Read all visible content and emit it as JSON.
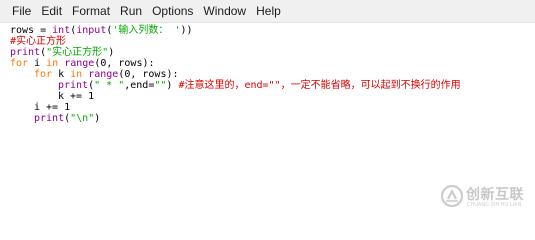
{
  "menu": {
    "items": [
      "File",
      "Edit",
      "Format",
      "Run",
      "Options",
      "Window",
      "Help"
    ]
  },
  "code": {
    "line1": {
      "a": "rows = ",
      "b": "int",
      "c": "(",
      "d": "input",
      "e": "(",
      "f": "'输入列数： '",
      "g": "))"
    },
    "line2": {
      "a": "#实心正方形"
    },
    "line3": {
      "a": "print",
      "b": "(",
      "c": "\"实心正方形\"",
      "d": ")"
    },
    "line4": {
      "a": "for",
      "b": " i ",
      "c": "in",
      "d": " ",
      "e": "range",
      "f": "(0, rows):"
    },
    "line5": {
      "a": "for",
      "b": " k ",
      "c": "in",
      "d": " ",
      "e": "range",
      "f": "(0, rows):"
    },
    "line6": {
      "a": "print",
      "b": "(",
      "c": "\" * \"",
      "d": ",end=",
      "e": "\"\"",
      "f": ") ",
      "g": "#注意这里的，end=\"\"，一定不能省略，可以起到不换行的作用"
    },
    "line7": {
      "a": "k += 1"
    },
    "line8": {
      "a": "i += 1"
    },
    "line9": {
      "a": "print",
      "b": "(",
      "c": "\"\\n\"",
      "d": ")"
    }
  },
  "watermark": {
    "brand": "创新互联",
    "sub": "CHUANG XIN HU LIAN"
  },
  "colors": {
    "keyword": "#ff7700",
    "builtin": "#900090",
    "string": "#00aa00",
    "comment": "#dd0000"
  }
}
